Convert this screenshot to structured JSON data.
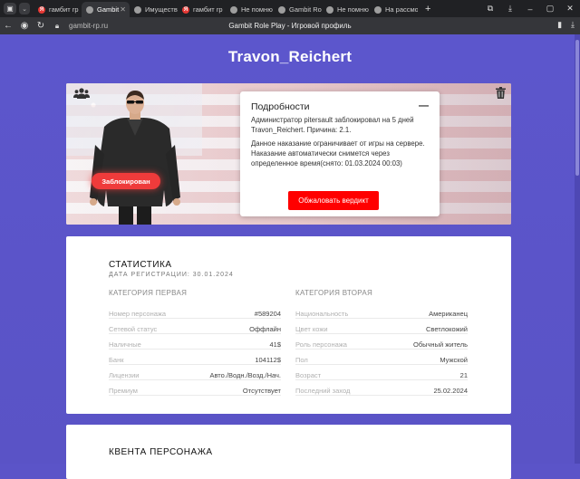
{
  "browser": {
    "tabs": [
      {
        "label": "гамбит rp",
        "favicon": "yandex",
        "active": false
      },
      {
        "label": "Gambit",
        "favicon": "globe",
        "active": true
      },
      {
        "label": "Имущество",
        "favicon": "globe",
        "active": false
      },
      {
        "label": "гамбит rp",
        "favicon": "yandex",
        "active": false
      },
      {
        "label": "Не помню",
        "favicon": "globe",
        "active": false
      },
      {
        "label": "Gambit Role",
        "favicon": "globe",
        "active": false
      },
      {
        "label": "Не помню",
        "favicon": "globe",
        "active": false
      },
      {
        "label": "На рассмо",
        "favicon": "globe",
        "active": false
      }
    ],
    "url": "gambit-rp.ru",
    "page_title": "Gambit Role Play - Игровой профиль"
  },
  "profile": {
    "username": "Travon_Reichert",
    "status_badge": "Заблокирован",
    "details": {
      "title": "Подробности",
      "text1": "Администратор pitersault заблокировал на 5 дней Travon_Reichert. Причина: 2.1.",
      "text2": "Данное наказание ограничивает от игры на сервере. Наказание автоматически снимется через определенное время(снято: 01.03.2024 00:03)",
      "appeal_button": "Обжаловать вердикт"
    }
  },
  "stats": {
    "title": "СТАТИСТИКА",
    "registration": "ДАТА РЕГИСТРАЦИИ: 30.01.2024",
    "left": {
      "heading": "КАТЕГОРИЯ ПЕРВАЯ",
      "rows": [
        {
          "k": "Номер персонажа",
          "v": "#589204"
        },
        {
          "k": "Сетевой статус",
          "v": "Оффлайн"
        },
        {
          "k": "Наличные",
          "v": "41$"
        },
        {
          "k": "Банк",
          "v": "104112$"
        },
        {
          "k": "Лицензии",
          "v": "Авто./Водн./Возд./Нач."
        },
        {
          "k": "Премиум",
          "v": "Отсутствует"
        }
      ]
    },
    "right": {
      "heading": "КАТЕГОРИЯ ВТОРАЯ",
      "rows": [
        {
          "k": "Национальность",
          "v": "Американец"
        },
        {
          "k": "Цвет кожи",
          "v": "Светлокожий"
        },
        {
          "k": "Роль персонажа",
          "v": "Обычный житель"
        },
        {
          "k": "Пол",
          "v": "Мужской"
        },
        {
          "k": "Возраст",
          "v": "21"
        },
        {
          "k": "Последний заход",
          "v": "25.02.2024"
        }
      ]
    }
  },
  "quests": {
    "title": "КВЕНТА ПЕРСОНАЖА"
  },
  "colors": {
    "page_bg": "#5b54c8",
    "accent_red": "#ff0000"
  }
}
